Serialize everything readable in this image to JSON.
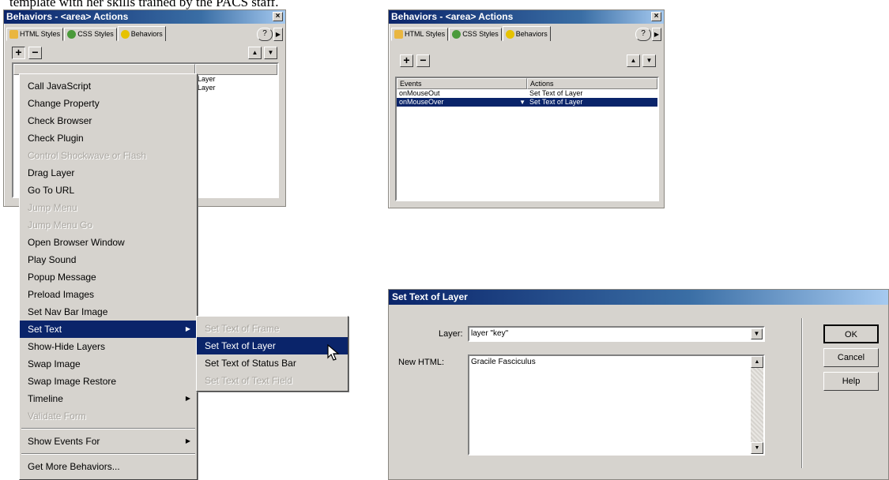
{
  "caption": "template with her skills trained by the PACS staff.",
  "left_panel": {
    "title": "Behaviors - <area> Actions",
    "tabs": [
      "HTML Styles",
      "CSS Styles",
      "Behaviors"
    ],
    "add": "+",
    "remove": "−",
    "actions_partial": [
      "Layer",
      "Layer"
    ]
  },
  "main_menu": {
    "items": [
      {
        "label": "Call JavaScript",
        "disabled": false
      },
      {
        "label": "Change Property",
        "disabled": false
      },
      {
        "label": "Check Browser",
        "disabled": false
      },
      {
        "label": "Check Plugin",
        "disabled": false
      },
      {
        "label": "Control Shockwave or Flash",
        "disabled": true
      },
      {
        "label": "Drag Layer",
        "disabled": false
      },
      {
        "label": "Go To URL",
        "disabled": false
      },
      {
        "label": "Jump Menu",
        "disabled": true
      },
      {
        "label": "Jump Menu Go",
        "disabled": true
      },
      {
        "label": "Open Browser Window",
        "disabled": false
      },
      {
        "label": "Play Sound",
        "disabled": false
      },
      {
        "label": "Popup Message",
        "disabled": false
      },
      {
        "label": "Preload Images",
        "disabled": false
      },
      {
        "label": "Set Nav Bar Image",
        "disabled": false
      },
      {
        "label": "Set Text",
        "disabled": false
      },
      {
        "label": "Show-Hide Layers",
        "disabled": false
      },
      {
        "label": "Swap Image",
        "disabled": false
      },
      {
        "label": "Swap Image Restore",
        "disabled": false
      },
      {
        "label": "Timeline",
        "disabled": false
      },
      {
        "label": "Validate Form",
        "disabled": true
      }
    ],
    "show_events": "Show Events For",
    "get_more": "Get More Behaviors..."
  },
  "submenu": {
    "items": [
      {
        "label": "Set Text of Frame",
        "disabled": true
      },
      {
        "label": "Set Text of Layer",
        "disabled": false
      },
      {
        "label": "Set Text of Status Bar",
        "disabled": false
      },
      {
        "label": "Set Text of Text Field",
        "disabled": true
      }
    ]
  },
  "right_panel": {
    "title": "Behaviors - <area> Actions",
    "tabs": [
      "HTML Styles",
      "CSS Styles",
      "Behaviors"
    ],
    "col_events": "Events",
    "col_actions": "Actions",
    "rows": [
      {
        "event": "onMouseOut",
        "action": "Set Text of Layer"
      },
      {
        "event": "onMouseOver",
        "action": "Set Text of Layer"
      }
    ]
  },
  "dialog": {
    "title": "Set Text of Layer",
    "layer_label": "Layer:",
    "layer_value": "layer \"key\"",
    "html_label": "New HTML:",
    "html_value": "Gracile Fasciculus",
    "ok": "OK",
    "cancel": "Cancel",
    "help": "Help"
  },
  "colors": {
    "selection": "#0a246a",
    "panel": "#d6d3ce"
  }
}
